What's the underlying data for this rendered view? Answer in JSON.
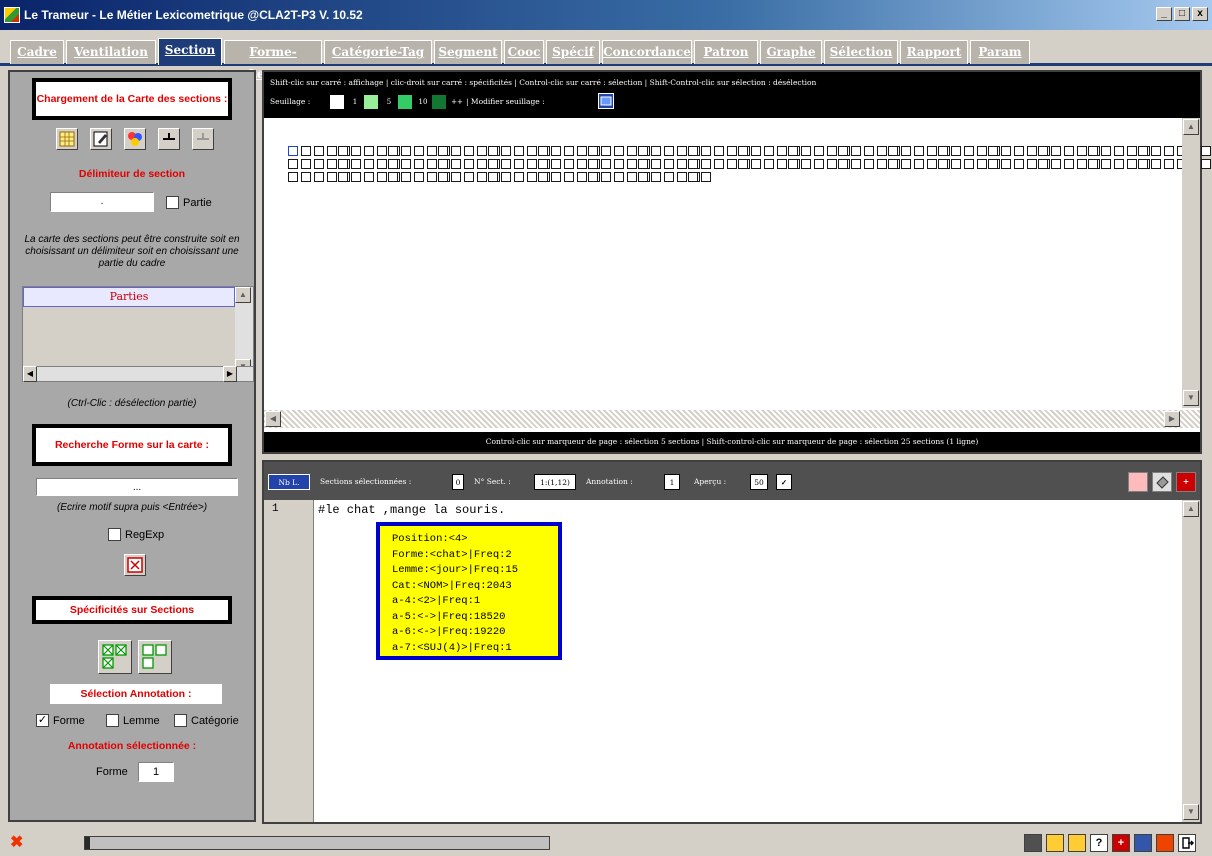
{
  "window": {
    "title": "Le Trameur - Le Métier Lexicometrique @CLA2T-P3 V. 10.52",
    "controls": [
      "_",
      "□",
      "x"
    ]
  },
  "tabs": [
    {
      "label": "Cadre"
    },
    {
      "label": "Ventilation"
    },
    {
      "label": "Section",
      "active": true
    },
    {
      "label": "Forme-Lemme"
    },
    {
      "label": "Catégorie-Tag"
    },
    {
      "label": "Segment"
    },
    {
      "label": "Cooc"
    },
    {
      "label": "Spécif"
    },
    {
      "label": "Concordance"
    },
    {
      "label": "Patron"
    },
    {
      "label": "Graphe"
    },
    {
      "label": "Sélection"
    },
    {
      "label": "Rapport"
    },
    {
      "label": "Param"
    }
  ],
  "left": {
    "chargement": "Chargement de la Carte des sections :",
    "delimiteur_title": "Délimiteur de section",
    "delimiteur_value": ".",
    "partie_label": "Partie",
    "help_text": "La carte des sections peut être construite soit en choisissant un délimiteur soit en choisissant une partie du cadre",
    "parties_header": "Parties",
    "ctrl_clic": "(Ctrl-Clic : désélection partie)",
    "recherche": "Recherche Forme sur la carte :",
    "search_value": "...",
    "ecrire": "(Ecrire motif supra puis <Entrée>)",
    "regexp_label": "RegExp",
    "specificites": "Spécificités sur Sections",
    "selection_annotation": "Sélection Annotation :",
    "forme_label": "Forme",
    "lemme_label": "Lemme",
    "categorie_label": "Catégorie",
    "annotation_selectionnee": "Annotation sélectionnée :",
    "annot_forme_label": "Forme",
    "annot_forme_value": "1"
  },
  "map": {
    "instructions": "Shift-clic sur carré : affichage | clic-droit sur carré : spécificités | Control-clic sur carré : sélection | Shift-Control-clic sur sélection : désélection",
    "seuillage_label": "Seuillage :",
    "thresholds": [
      {
        "value": "1",
        "color": "#ffffff"
      },
      {
        "value": "5",
        "color": "#99ee99"
      },
      {
        "value": "10",
        "color": "#33cc66"
      },
      {
        "value": "++",
        "color": "#117733"
      }
    ],
    "modifier": "| Modifier seuillage :",
    "section_count": 232,
    "footer": "Control-clic sur marqueur de page : sélection 5 sections | Shift-control-clic sur marqueur de page : sélection 25 sections (1 ligne)"
  },
  "bottom": {
    "nb_l": "Nb L.",
    "sections_label": "Sections sélectionnées :",
    "sections_value": "0",
    "nsect_label": "N° Sect. :",
    "nsect_value": "1:(1,12)",
    "annotation_label": "Annotation :",
    "annotation_value": "1",
    "apercu_label": "Aperçu :",
    "apercu_value": "50",
    "line_number": "1",
    "line_text": "#le chat ,mange la souris.",
    "tooltip": [
      "Position:<4>",
      "Forme:<chat>|Freq:2",
      "Lemme:<jour>|Freq:15",
      "Cat:<NOM>|Freq:2043",
      "a-4:<2>|Freq:1",
      "a-5:<->|Freq:18520",
      "a-6:<->|Freq:19220",
      "a-7:<SUJ(4)>|Freq:1"
    ]
  },
  "status": {
    "progress": 0.01
  }
}
